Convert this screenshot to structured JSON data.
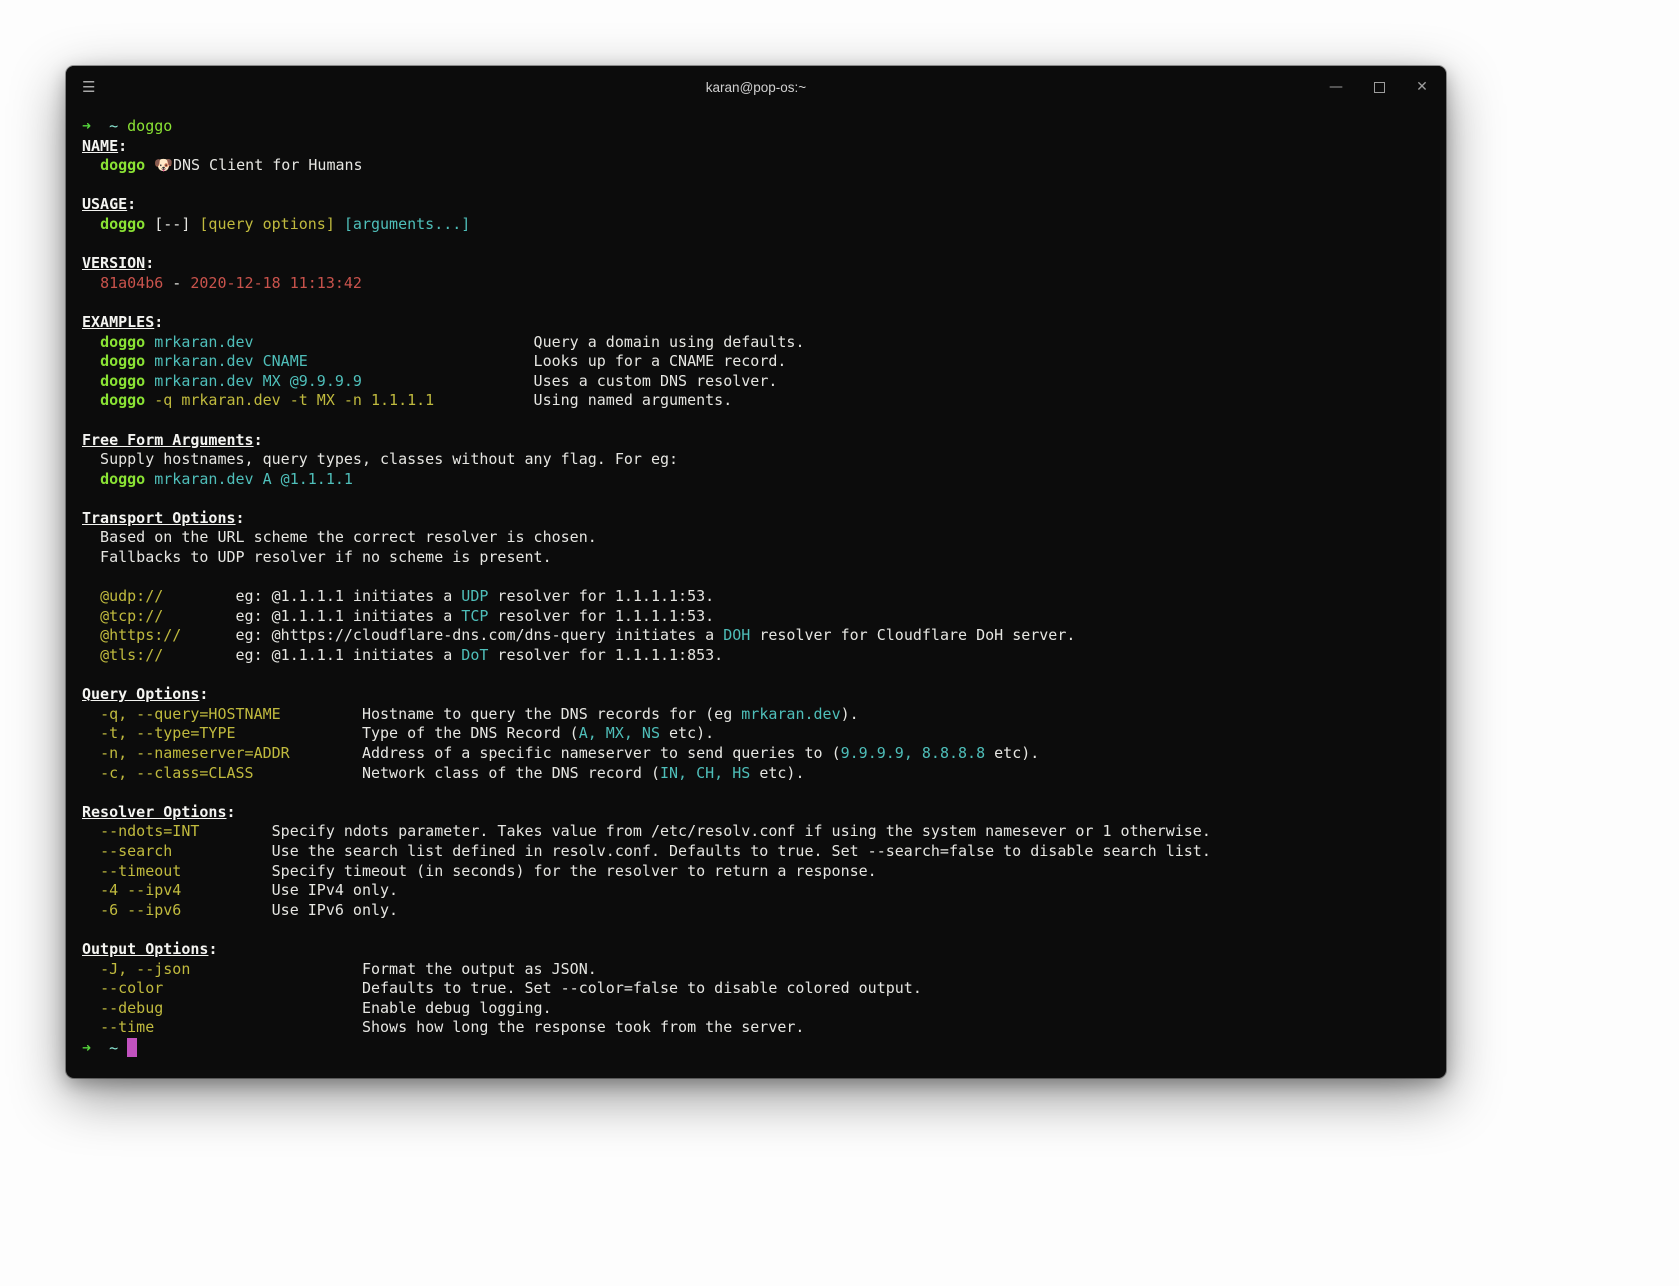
{
  "window": {
    "title": "karan@pop-os:~",
    "icons": {
      "menu": "☰",
      "minimize": "—",
      "maximize": "square-outline",
      "close": "✕"
    }
  },
  "colors": {
    "background": "#0c0c0c",
    "white": "#e6e6e2",
    "heading": "#f4f4f1",
    "green": "#8ae234",
    "arrow": "#55d43c",
    "tilde": "#8ce8d5",
    "cyan": "#4fbfba",
    "yellow": "#c0ba3e",
    "red": "#c9534c",
    "magenta": "#c152bf",
    "title_text": "#d0d0d0",
    "control_gray": "#9d9d9d"
  },
  "terminal": {
    "lines": [
      [
        {
          "t": "➜",
          "c": "arrow",
          "b": true
        },
        {
          "t": "  ",
          "c": "white"
        },
        {
          "t": "~",
          "c": "tilde"
        },
        {
          "t": " ",
          "c": "white"
        },
        {
          "t": "doggo",
          "c": "green"
        }
      ],
      [
        {
          "t": "NAME",
          "c": "heading",
          "b": true,
          "u": true
        },
        {
          "t": ":",
          "c": "heading",
          "b": true
        }
      ],
      [
        {
          "t": "  ",
          "c": "white"
        },
        {
          "t": "doggo",
          "c": "green",
          "b": true
        },
        {
          "t": " ",
          "c": "white"
        },
        {
          "t": "🐶",
          "c": "white"
        },
        {
          "t": "DNS Client for Humans",
          "c": "white"
        }
      ],
      [],
      [
        {
          "t": "USAGE",
          "c": "heading",
          "b": true,
          "u": true
        },
        {
          "t": ":",
          "c": "heading",
          "b": true
        }
      ],
      [
        {
          "t": "  ",
          "c": "white"
        },
        {
          "t": "doggo",
          "c": "green",
          "b": true
        },
        {
          "t": " [--] ",
          "c": "white"
        },
        {
          "t": "[query options]",
          "c": "yellow"
        },
        {
          "t": " ",
          "c": "white"
        },
        {
          "t": "[arguments...]",
          "c": "cyan"
        }
      ],
      [],
      [
        {
          "t": "VERSION",
          "c": "heading",
          "b": true,
          "u": true
        },
        {
          "t": ":",
          "c": "heading",
          "b": true
        }
      ],
      [
        {
          "t": "  ",
          "c": "white"
        },
        {
          "t": "81a04b6",
          "c": "red"
        },
        {
          "t": " - ",
          "c": "white"
        },
        {
          "t": "2020-12-18 11:13:42",
          "c": "red"
        }
      ],
      [],
      [
        {
          "t": "EXAMPLES",
          "c": "heading",
          "b": true,
          "u": true
        },
        {
          "t": ":",
          "c": "heading",
          "b": true
        }
      ],
      [
        {
          "t": "  ",
          "c": "white"
        },
        {
          "t": "doggo",
          "c": "green",
          "b": true
        },
        {
          "t": " mrkaran.dev",
          "c": "cyan"
        },
        {
          "t": "                               Query a domain using defaults.",
          "c": "white"
        }
      ],
      [
        {
          "t": "  ",
          "c": "white"
        },
        {
          "t": "doggo",
          "c": "green",
          "b": true
        },
        {
          "t": " mrkaran.dev CNAME",
          "c": "cyan"
        },
        {
          "t": "                         Looks up for a CNAME record.",
          "c": "white"
        }
      ],
      [
        {
          "t": "  ",
          "c": "white"
        },
        {
          "t": "doggo",
          "c": "green",
          "b": true
        },
        {
          "t": " mrkaran.dev MX @9.9.9.9",
          "c": "cyan"
        },
        {
          "t": "                   Uses a custom DNS resolver.",
          "c": "white"
        }
      ],
      [
        {
          "t": "  ",
          "c": "white"
        },
        {
          "t": "doggo",
          "c": "green",
          "b": true
        },
        {
          "t": " -q mrkaran.dev -t MX -n 1.1.1.1",
          "c": "yellow"
        },
        {
          "t": "           Using named arguments.",
          "c": "white"
        }
      ],
      [],
      [
        {
          "t": "Free Form Arguments",
          "c": "heading",
          "b": true,
          "u": true
        },
        {
          "t": ":",
          "c": "heading",
          "b": true
        }
      ],
      [
        {
          "t": "  Supply hostnames, query types, classes without any flag. For eg:",
          "c": "white"
        }
      ],
      [
        {
          "t": "  ",
          "c": "white"
        },
        {
          "t": "doggo",
          "c": "green",
          "b": true
        },
        {
          "t": " mrkaran.dev A @1.1.1.1",
          "c": "cyan"
        }
      ],
      [],
      [
        {
          "t": "Transport Options",
          "c": "heading",
          "b": true,
          "u": true
        },
        {
          "t": ":",
          "c": "heading",
          "b": true
        }
      ],
      [
        {
          "t": "  Based on the URL scheme the correct resolver is chosen.",
          "c": "white"
        }
      ],
      [
        {
          "t": "  Fallbacks to UDP resolver if no scheme is present.",
          "c": "white"
        }
      ],
      [],
      [
        {
          "t": "  ",
          "c": "white"
        },
        {
          "t": "@udp://",
          "c": "yellow"
        },
        {
          "t": "        eg: @1.1.1.1 initiates a ",
          "c": "white"
        },
        {
          "t": "UDP",
          "c": "cyan"
        },
        {
          "t": " resolver for 1.1.1.1:53.",
          "c": "white"
        }
      ],
      [
        {
          "t": "  ",
          "c": "white"
        },
        {
          "t": "@tcp://",
          "c": "yellow"
        },
        {
          "t": "        eg: @1.1.1.1 initiates a ",
          "c": "white"
        },
        {
          "t": "TCP",
          "c": "cyan"
        },
        {
          "t": " resolver for 1.1.1.1:53.",
          "c": "white"
        }
      ],
      [
        {
          "t": "  ",
          "c": "white"
        },
        {
          "t": "@https://",
          "c": "yellow"
        },
        {
          "t": "      eg: @https://cloudflare-dns.com/dns-query initiates a ",
          "c": "white"
        },
        {
          "t": "DOH",
          "c": "cyan"
        },
        {
          "t": " resolver for Cloudflare DoH server.",
          "c": "white"
        }
      ],
      [
        {
          "t": "  ",
          "c": "white"
        },
        {
          "t": "@tls://",
          "c": "yellow"
        },
        {
          "t": "        eg: @1.1.1.1 initiates a ",
          "c": "white"
        },
        {
          "t": "DoT",
          "c": "cyan"
        },
        {
          "t": " resolver for 1.1.1.1:853.",
          "c": "white"
        }
      ],
      [],
      [
        {
          "t": "Query Options",
          "c": "heading",
          "b": true,
          "u": true
        },
        {
          "t": ":",
          "c": "heading",
          "b": true
        }
      ],
      [
        {
          "t": "  ",
          "c": "white"
        },
        {
          "t": "-q, --query=HOSTNAME",
          "c": "yellow"
        },
        {
          "t": "         Hostname to query the DNS records for (eg ",
          "c": "white"
        },
        {
          "t": "mrkaran.dev",
          "c": "cyan"
        },
        {
          "t": ").",
          "c": "white"
        }
      ],
      [
        {
          "t": "  ",
          "c": "white"
        },
        {
          "t": "-t, --type=TYPE",
          "c": "yellow"
        },
        {
          "t": "              Type of the DNS Record (",
          "c": "white"
        },
        {
          "t": "A, MX, NS",
          "c": "cyan"
        },
        {
          "t": " etc).",
          "c": "white"
        }
      ],
      [
        {
          "t": "  ",
          "c": "white"
        },
        {
          "t": "-n, --nameserver=ADDR",
          "c": "yellow"
        },
        {
          "t": "        Address of a specific nameserver to send queries to (",
          "c": "white"
        },
        {
          "t": "9.9.9.9, 8.8.8.8",
          "c": "cyan"
        },
        {
          "t": " etc).",
          "c": "white"
        }
      ],
      [
        {
          "t": "  ",
          "c": "white"
        },
        {
          "t": "-c, --class=CLASS",
          "c": "yellow"
        },
        {
          "t": "            Network class of the DNS record (",
          "c": "white"
        },
        {
          "t": "IN, CH, HS",
          "c": "cyan"
        },
        {
          "t": " etc).",
          "c": "white"
        }
      ],
      [],
      [
        {
          "t": "Resolver Options",
          "c": "heading",
          "b": true,
          "u": true
        },
        {
          "t": ":",
          "c": "heading",
          "b": true
        }
      ],
      [
        {
          "t": "  ",
          "c": "white"
        },
        {
          "t": "--ndots=INT",
          "c": "yellow"
        },
        {
          "t": "        Specify ndots parameter. Takes value from /etc/resolv.conf if using the system namesever or 1 otherwise.",
          "c": "white"
        }
      ],
      [
        {
          "t": "  ",
          "c": "white"
        },
        {
          "t": "--search",
          "c": "yellow"
        },
        {
          "t": "           Use the search list defined in resolv.conf. Defaults to true. Set --search=false to disable search list.",
          "c": "white"
        }
      ],
      [
        {
          "t": "  ",
          "c": "white"
        },
        {
          "t": "--timeout",
          "c": "yellow"
        },
        {
          "t": "          Specify timeout (in seconds) for the resolver to return a response.",
          "c": "white"
        }
      ],
      [
        {
          "t": "  ",
          "c": "white"
        },
        {
          "t": "-4 --ipv4",
          "c": "yellow"
        },
        {
          "t": "          Use IPv4 only.",
          "c": "white"
        }
      ],
      [
        {
          "t": "  ",
          "c": "white"
        },
        {
          "t": "-6 --ipv6",
          "c": "yellow"
        },
        {
          "t": "          Use IPv6 only.",
          "c": "white"
        }
      ],
      [],
      [
        {
          "t": "Output Options",
          "c": "heading",
          "b": true,
          "u": true
        },
        {
          "t": ":",
          "c": "heading",
          "b": true
        }
      ],
      [
        {
          "t": "  ",
          "c": "white"
        },
        {
          "t": "-J, --json",
          "c": "yellow"
        },
        {
          "t": "                   Format the output as JSON.",
          "c": "white"
        }
      ],
      [
        {
          "t": "  ",
          "c": "white"
        },
        {
          "t": "--color",
          "c": "yellow"
        },
        {
          "t": "                      Defaults to true. Set --color=false to disable colored output.",
          "c": "white"
        }
      ],
      [
        {
          "t": "  ",
          "c": "white"
        },
        {
          "t": "--debug",
          "c": "yellow"
        },
        {
          "t": "                      Enable debug logging.",
          "c": "white"
        }
      ],
      [
        {
          "t": "  ",
          "c": "white"
        },
        {
          "t": "--time",
          "c": "yellow"
        },
        {
          "t": "                       Shows how long the response took from the server.",
          "c": "white"
        }
      ],
      [
        {
          "t": "➜",
          "c": "arrow",
          "b": true
        },
        {
          "t": "  ",
          "c": "white"
        },
        {
          "t": "~",
          "c": "tilde"
        },
        {
          "t": " ",
          "c": "white"
        },
        {
          "cur": true
        }
      ]
    ]
  }
}
